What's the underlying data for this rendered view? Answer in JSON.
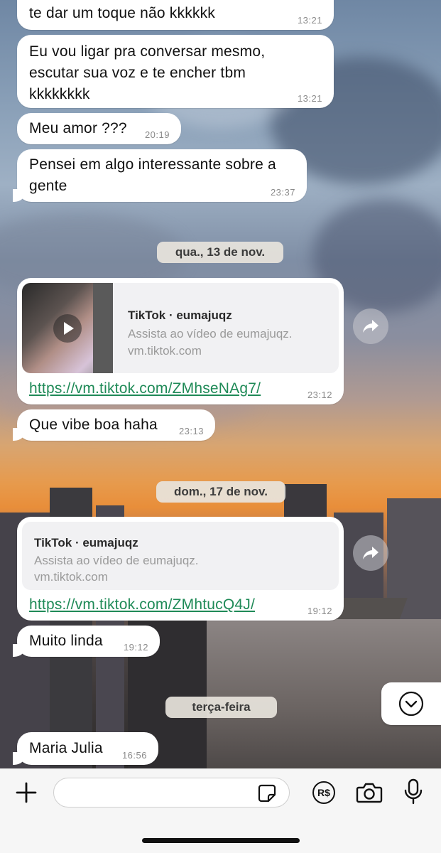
{
  "messages": [
    {
      "text": "te dar um toque não kkkkkk",
      "time": "13:21"
    },
    {
      "text": "Eu vou ligar pra conversar mesmo, escutar sua voz e te encher tbm kkkkkkkk",
      "time": "13:21"
    },
    {
      "text": "Meu amor ???",
      "time": "20:19"
    },
    {
      "text": "Pensei em algo interessante sobre a gente",
      "time": "23:37"
    },
    {
      "text": "Que vibe boa haha",
      "time": "23:13"
    },
    {
      "text": "Muito linda",
      "time": "19:12"
    },
    {
      "text": "Maria Julia",
      "time": "16:56"
    }
  ],
  "dates": {
    "wed": "qua., 13 de nov.",
    "sun": "dom., 17 de nov.",
    "tue": "terça-feira"
  },
  "link_messages": [
    {
      "card_title": "TikTok · eumajuqz",
      "card_desc": "Assista ao vídeo de eumajuqz.",
      "card_domain": "vm.tiktok.com",
      "url": "https://vm.tiktok.com/ZMhseNAg7/",
      "time": "23:12",
      "has_thumbnail": true
    },
    {
      "card_title": "TikTok · eumajuqz",
      "card_desc": "Assista ao vídeo de eumajuqz.",
      "card_domain": "vm.tiktok.com",
      "url": "https://vm.tiktok.com/ZMhtucQ4J/",
      "time": "19:12",
      "has_thumbnail": false
    }
  ],
  "input_bar": {
    "icons": [
      "plus-icon",
      "sticker-icon",
      "pix-payment-icon",
      "camera-icon",
      "microphone-icon"
    ],
    "payment_icon_label": "R$"
  },
  "colors": {
    "link": "#1f8a57",
    "bubble": "#ffffff",
    "date_pill": "#e8e4dc"
  }
}
